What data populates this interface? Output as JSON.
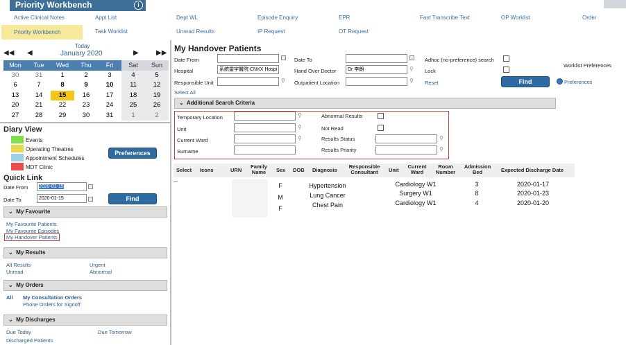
{
  "app": {
    "title": "Priority Workbench",
    "info_icon": "i"
  },
  "menu": {
    "row1": [
      "Active Clinical Notes",
      "Appt List",
      "Dept WL",
      "Episode Enquiry",
      "EPR",
      "Fast Transcribe Text",
      "OP Worklist",
      "Order"
    ],
    "row2": [
      "Priority Workbench",
      "Task Worklist",
      "Unread Results",
      "IP Request",
      "OT Request"
    ]
  },
  "calendar": {
    "today": "Today",
    "month": "January 2020",
    "days": [
      "Mon",
      "Tue",
      "Wed",
      "Thu",
      "Fri",
      "Sat",
      "Sun"
    ],
    "weeks": [
      [
        "30",
        "31",
        "1",
        "2",
        "3",
        "4",
        "5"
      ],
      [
        "6",
        "7",
        "8",
        "9",
        "10",
        "11",
        "12"
      ],
      [
        "13",
        "14",
        "15",
        "16",
        "17",
        "18",
        "19"
      ],
      [
        "20",
        "21",
        "22",
        "23",
        "24",
        "25",
        "26"
      ],
      [
        "27",
        "28",
        "29",
        "30",
        "31",
        "1",
        "2"
      ]
    ]
  },
  "diary": {
    "title": "Diary View",
    "legend": [
      {
        "label": "Events",
        "color": "#7ee04a"
      },
      {
        "label": "Operating Theatres",
        "color": "#e8d84e"
      },
      {
        "label": "Appointment Schedules",
        "color": "#9fcfe3"
      },
      {
        "label": "MDT Clinic",
        "color": "#f04a4a"
      }
    ],
    "preferences": "Preferences"
  },
  "quicklink": {
    "title": "Quick Link",
    "date_from_label": "Date From",
    "date_from": "2020-01-15",
    "date_to_label": "Date To",
    "date_to": "2020-01-15",
    "find": "Find"
  },
  "favourites": {
    "header": "My Favourite",
    "items": [
      "My Favourite Patients",
      "My Favourite Episodes",
      "My Handover Patients"
    ]
  },
  "results": {
    "header": "My Results",
    "left": [
      "All Results",
      "Unread"
    ],
    "right": [
      "Urgent",
      "Abnormal"
    ]
  },
  "orders": {
    "header": "My Orders",
    "all": "All",
    "items": [
      "My Consultation Orders",
      "Phone Orders for Signoff"
    ]
  },
  "discharges": {
    "header": "My Discharges",
    "items": [
      "Due Today",
      "Due Tomorrow",
      "Discharged Patients"
    ]
  },
  "handover": {
    "title": "My Handover Patients",
    "date_from": "Date From",
    "date_to": "Date To",
    "adhoc": "Adhoc (no-preference) search",
    "hospital": "Hospital",
    "hospital_value": "系統靈宇醫院 CNXX Hospi",
    "handover_doctor": "Hand Over Doctor",
    "handover_doctor_value": "Dr 李朗",
    "lock": "Lock",
    "worklist_prefs": "Worklist Preferences",
    "responsible_unit": "Responsible Unit",
    "outpatient_location": "Outpatient Location",
    "reset": "Reset",
    "find": "Find",
    "preferences": "Preferences",
    "select_all": "Select All",
    "additional": "Additional Search Criteria",
    "temp_location": "Temporary Location",
    "unit": "Unit",
    "current_ward": "Current Ward",
    "surname": "Surname",
    "abnormal_results": "Abnormal Results",
    "not_read": "Not Read",
    "results_status": "Results Status",
    "results_priority": "Results Priority"
  },
  "table": {
    "headers": [
      "Select",
      "Icons",
      "URN",
      "Family Name",
      "Sex",
      "DOB",
      "Diagnosis",
      "Responsible Consultant",
      "Unit",
      "Current Ward",
      "Room Number",
      "Admission Bed",
      "Expected Discharge Date"
    ],
    "rows": [
      {
        "sex": "F",
        "diagnosis": "Hypertension",
        "ward": "Cardiology W1",
        "bed": "3",
        "discharge": "2020-01-17"
      },
      {
        "sex": "M",
        "diagnosis": "Lung Cancer",
        "ward": "Surgery W1",
        "bed": "8",
        "discharge": "2020-01-23"
      },
      {
        "sex": "F",
        "diagnosis": "Chest Pain",
        "ward": "Cardiology W1",
        "bed": "4",
        "discharge": "2020-01-20"
      }
    ]
  }
}
